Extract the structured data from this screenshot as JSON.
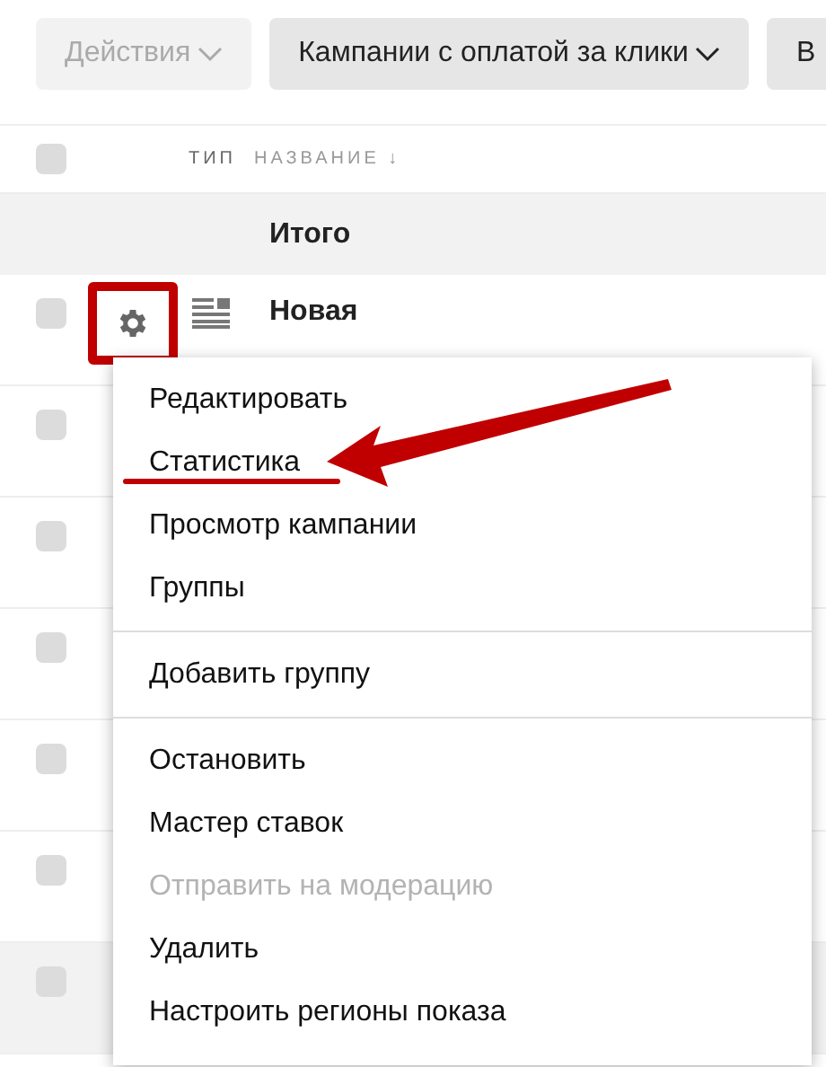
{
  "toolbar": [
    {
      "label": "Действия",
      "disabled": true,
      "caret": true
    },
    {
      "label": "Кампании с оплатой за клики",
      "disabled": false,
      "caret": true
    },
    {
      "label": "В",
      "disabled": false,
      "caret": false
    }
  ],
  "table": {
    "header_checkbox": {
      "checked": false
    },
    "columns": [
      "ТИП",
      "НАЗВАНИЕ ↓"
    ],
    "total_row": {
      "label": "Итого"
    },
    "rows": [
      {
        "name": "Новая",
        "checked": false,
        "highlighted": false,
        "settings_open": true
      },
      {
        "checked": false,
        "highlighted": false
      },
      {
        "checked": false,
        "highlighted": false
      },
      {
        "checked": false,
        "highlighted": false
      },
      {
        "checked": false,
        "highlighted": false
      },
      {
        "checked": false,
        "highlighted": false
      },
      {
        "checked": false,
        "highlighted": true
      }
    ]
  },
  "menu": {
    "groups": [
      [
        {
          "label": "Редактировать",
          "disabled": false,
          "marked": false
        },
        {
          "label": "Статистика",
          "disabled": false,
          "marked": true
        },
        {
          "label": "Просмотр кампании",
          "disabled": false,
          "marked": false
        },
        {
          "label": "Группы",
          "disabled": false,
          "marked": false
        }
      ],
      [
        {
          "label": "Добавить группу",
          "disabled": false,
          "marked": false
        }
      ],
      [
        {
          "label": "Остановить",
          "disabled": false,
          "marked": false
        },
        {
          "label": "Мастер ставок",
          "disabled": false,
          "marked": false
        },
        {
          "label": "Отправить на модерацию",
          "disabled": true,
          "marked": false
        },
        {
          "label": "Удалить",
          "disabled": false,
          "marked": false
        },
        {
          "label": "Настроить регионы показа",
          "disabled": false,
          "marked": false
        }
      ]
    ]
  }
}
